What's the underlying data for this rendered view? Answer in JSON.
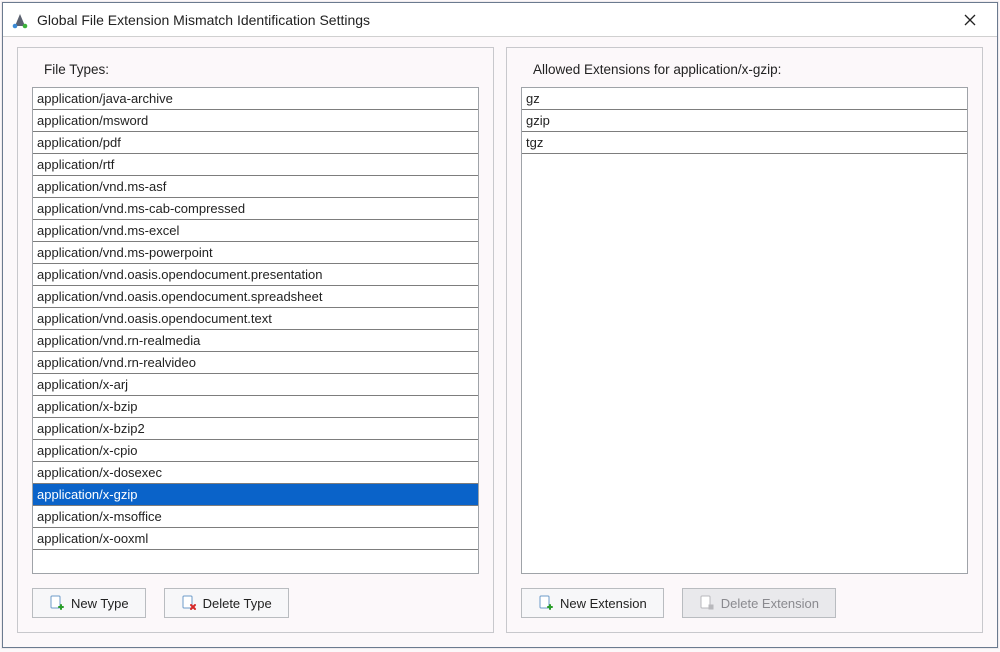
{
  "window": {
    "title": "Global File Extension Mismatch Identification Settings"
  },
  "left": {
    "label": "File Types:",
    "items": [
      "application/java-archive",
      "application/msword",
      "application/pdf",
      "application/rtf",
      "application/vnd.ms-asf",
      "application/vnd.ms-cab-compressed",
      "application/vnd.ms-excel",
      "application/vnd.ms-powerpoint",
      "application/vnd.oasis.opendocument.presentation",
      "application/vnd.oasis.opendocument.spreadsheet",
      "application/vnd.oasis.opendocument.text",
      "application/vnd.rn-realmedia",
      "application/vnd.rn-realvideo",
      "application/x-arj",
      "application/x-bzip",
      "application/x-bzip2",
      "application/x-cpio",
      "application/x-dosexec",
      "application/x-gzip",
      "application/x-msoffice",
      "application/x-ooxml"
    ],
    "selected_index": 18,
    "buttons": {
      "new": "New Type",
      "delete": "Delete Type"
    }
  },
  "right": {
    "label_prefix": "Allowed Extensions for ",
    "selected_type": "application/x-gzip",
    "label_suffix": ":",
    "items": [
      "gz",
      "gzip",
      "tgz"
    ],
    "buttons": {
      "new": "New Extension",
      "delete": "Delete Extension"
    }
  }
}
